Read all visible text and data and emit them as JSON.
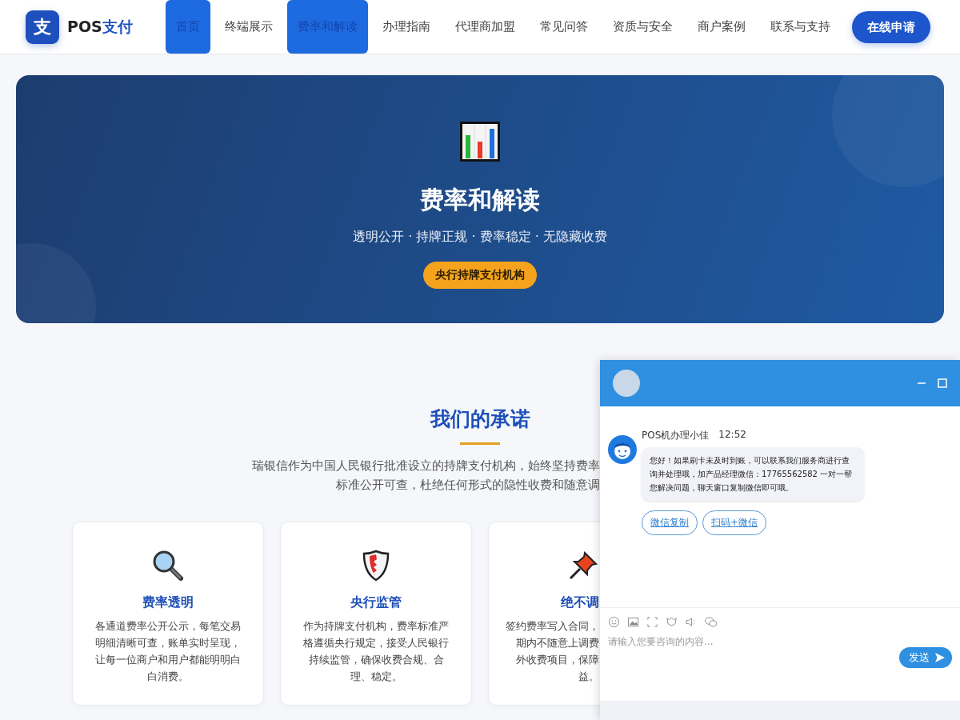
{
  "header": {
    "logo_mark": "支",
    "logo_prefix": "POS",
    "logo_suffix": "支付",
    "nav": [
      {
        "label": "首页",
        "selected": true
      },
      {
        "label": "终端展示",
        "selected": false
      },
      {
        "label": "费率和解读",
        "selected": true
      },
      {
        "label": "办理指南",
        "selected": false
      },
      {
        "label": "代理商加盟",
        "selected": false
      },
      {
        "label": "常见问答",
        "selected": false
      },
      {
        "label": "资质与安全",
        "selected": false
      },
      {
        "label": "商户案例",
        "selected": false
      },
      {
        "label": "联系与支持",
        "selected": false
      }
    ],
    "cta": "在线申请"
  },
  "hero": {
    "title": "费率和解读",
    "subtitle": "透明公开 · 持牌正规 · 费率稳定 · 无隐藏收费",
    "badge": "央行持牌支付机构"
  },
  "promise": {
    "title": "我们的承诺",
    "intro_lines": [
      "瑞银信作为中国人民银行批准设立的持牌支付机构，始终坚持费率",
      "标准公开可查，杜绝任何形式的隐性收费和随意调"
    ],
    "cards": [
      {
        "kind": "full",
        "title": "费率透明",
        "text": "各通道费率公开公示，每笔交易明细清晰可查，账单实时呈现，让每一位商户和用户都能明明白白消费。"
      },
      {
        "kind": "full",
        "title": "央行监管",
        "text": "作为持牌支付机构，费率标准严格遵循央行规定，接受人民银行持续监管，确保收费合规、合理、稳定。"
      },
      {
        "kind": "covered",
        "title": "绝不调",
        "lines": [
          "签约费率写入合同，",
          "期内不随意上调费",
          "外收费项目，保障",
          "益。"
        ]
      }
    ]
  },
  "chat": {
    "agent": "POS机办理小佳",
    "time": "12:52",
    "message": "您好！如果刷卡未及时到账，可以联系我们服务商进行查询并处理哦，加产品经理微信：17765562582 一对一帮您解决问题，聊天窗口复制微信即可哦。",
    "actions": [
      "微信复制",
      "扫码+微信"
    ],
    "placeholder": "请输入您要咨询的内容...",
    "send": "发送"
  }
}
